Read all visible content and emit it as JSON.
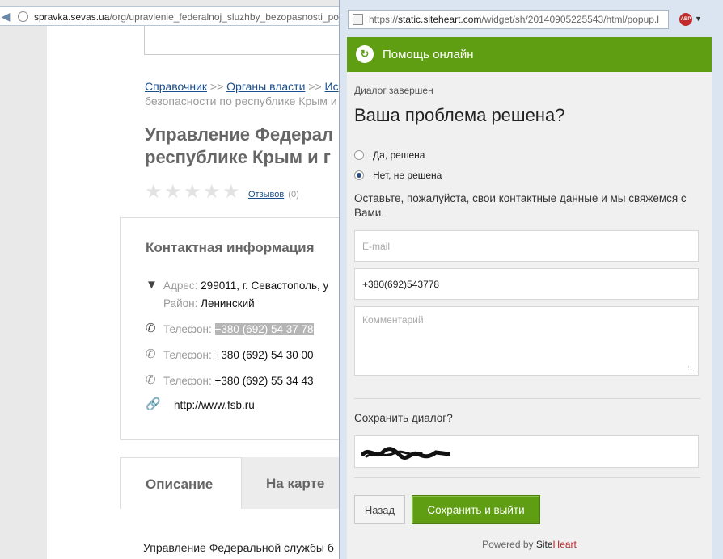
{
  "background_browser": {
    "back_icon": "back-arrow-icon",
    "url_host": "spravka.sevas.ua",
    "url_path": "/org/upravlenie_federalnoj_sluzhby_bezopasnosti_po_r",
    "url_scheme": "",
    "page": {
      "breadcrumb": {
        "item1": "Справочник",
        "sep1": ">>",
        "item2": "Органы власти",
        "sep2": ">>",
        "item3": "Ис",
        "line2": "безопасности по республике Крым и"
      },
      "title_line1": "Управление Федерал",
      "title_line2": "республике Крым и г",
      "reviews_label": "Отзывов",
      "reviews_count": "(0)",
      "contact": {
        "heading": "Контактная информация",
        "address_label": "Адрес:",
        "address_value": "299011, г. Севастополь, у",
        "district_label": "Район:",
        "district_value": "Ленинский",
        "phone_label": "Телефон:",
        "phones": [
          "+380 (692) 54 37 78",
          "+380 (692) 54 30 00",
          "+380 (692) 55 34 43"
        ],
        "website": "http://www.fsb.ru"
      },
      "tabs": {
        "description": "Описание",
        "map": "На карте"
      },
      "description_text": "Управление Федеральной службы б"
    }
  },
  "popup_browser": {
    "url_host": "static.siteheart.com",
    "url_prefix": "https://",
    "url_path": "/widget/sh/20140905225543/html/popup.l",
    "addon_label": "ABP"
  },
  "widget": {
    "header_title": "Помощь онлайн",
    "header_icon": "chat-bubble-icon",
    "dialog_status": "Диалог завершен",
    "question": "Ваша проблема решена?",
    "options": [
      {
        "label": "Да, решена",
        "selected": false
      },
      {
        "label": "Нет, не решена",
        "selected": true
      }
    ],
    "prompt": "Оставьте, пожалуйста, свои контактные данные и мы свяжемся с Вами.",
    "email_placeholder": "E-mail",
    "email_value": "",
    "phone_value": "+380(692)543778",
    "comment_placeholder": "Комментарий",
    "save_dialog_label": "Сохранить диалог?",
    "back_button": "Назад",
    "save_exit_button": "Сохранить и выйти",
    "powered_prefix": "Powered by",
    "powered_brand_site": "Site",
    "powered_brand_heart": "Heart",
    "colors": {
      "accent_green": "#5f9e12",
      "brand_red": "#b52a2a"
    }
  }
}
